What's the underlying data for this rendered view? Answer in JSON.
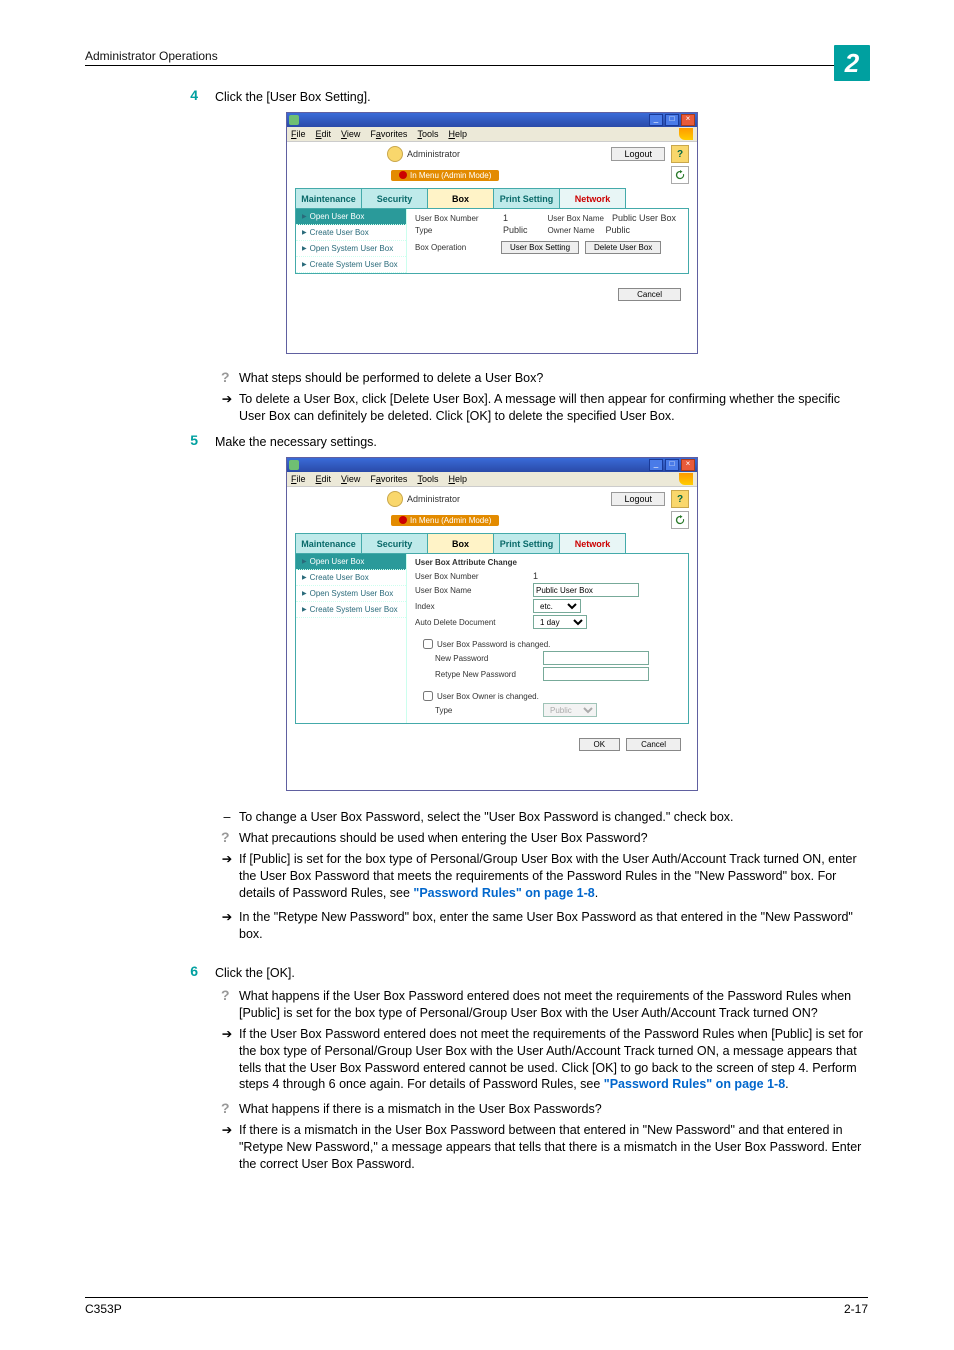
{
  "header": {
    "title": "Administrator Operations",
    "chapter": "2"
  },
  "footer": {
    "model": "C353P",
    "page": "2-17"
  },
  "steps": {
    "s4": {
      "num": "4",
      "text": "Click the [User Box Setting].",
      "q": "What steps should be performed to delete a User Box?",
      "a": "To delete a User Box, click [Delete User Box]. A message will then appear for confirming whether the specific User Box can definitely be deleted. Click [OK] to delete the specified User Box."
    },
    "s5": {
      "num": "5",
      "text": "Make the necessary settings.",
      "d": "To change a User Box Password, select the \"User Box Password is changed.\" check box.",
      "q": "What precautions should be used when entering the User Box Password?",
      "a1a": "If [Public] is set for the box type of Personal/Group User Box with the User Auth/Account Track turned ON, enter the User Box Password that meets the requirements of the Password Rules in the \"New Password\" box. For details of Password Rules, see ",
      "a1link": "\"Password Rules\" on page 1-8",
      "a1b": ".",
      "a2": "In the \"Retype New Password\" box, enter the same User Box Password as that entered in the \"New Password\" box."
    },
    "s6": {
      "num": "6",
      "text": "Click the [OK].",
      "q1": "What happens if the User Box Password entered does not meet the requirements of the Password Rules when [Public] is set for the box type of Personal/Group User Box with the User Auth/Account Track turned ON?",
      "a1a": "If the User Box Password entered does not meet the requirements of the Password Rules when [Public] is set for the box type of Personal/Group User Box with the User Auth/Account Track turned ON, a message appears that tells that the User Box Password entered cannot be used. Click [OK] to go back to the screen of step 4. Perform steps 4 through 6 once again. For details of Password Rules, see ",
      "a1link": "\"Password Rules\" on page 1-8",
      "a1b": ".",
      "q2": "What happens if there is a mismatch in the User Box Passwords?",
      "a2": "If there is a mismatch in the User Box Password between that entered in \"New Password\" and that entered in \"Retype New Password,\" a message appears that tells that there is a mismatch in the User Box Password. Enter the correct User Box Password."
    }
  },
  "shotA": {
    "menus": [
      "File",
      "Edit",
      "View",
      "Favorites",
      "Tools",
      "Help"
    ],
    "admin": "Administrator",
    "logout": "Logout",
    "mode": "In Menu (Admin Mode)",
    "tabs": [
      "Maintenance",
      "Security",
      "Box",
      "Print Setting",
      "Network"
    ],
    "side": [
      "Open User Box",
      "Create User Box",
      "Open System User Box",
      "Create System User Box"
    ],
    "row1_k": "User Box Number",
    "row1_v": "1",
    "row1b_k": "User Box Name",
    "row1b_v": "Public User Box",
    "row2_k": "Type",
    "row2_v": "Public",
    "row2b_k": "Owner Name",
    "row2b_v": "Public",
    "bo": "Box Operation",
    "btn1": "User Box Setting",
    "btn2": "Delete User Box",
    "cancel": "Cancel"
  },
  "shotB": {
    "heading": "User Box Attribute Change",
    "rows": {
      "ubn_k": "User Box Number",
      "ubn_v": "1",
      "ubname_k": "User Box Name",
      "ubname_v": "Public User Box",
      "idx_k": "Index",
      "idx_v": "etc.",
      "add_k": "Auto Delete Document",
      "add_v": "1 day"
    },
    "chk1": "User Box Password is changed.",
    "np": "New Password",
    "rnp": "Retype New Password",
    "chk2": "User Box Owner is changed.",
    "type_k": "Type",
    "type_v": "Public",
    "ok": "OK",
    "cancel": "Cancel"
  }
}
